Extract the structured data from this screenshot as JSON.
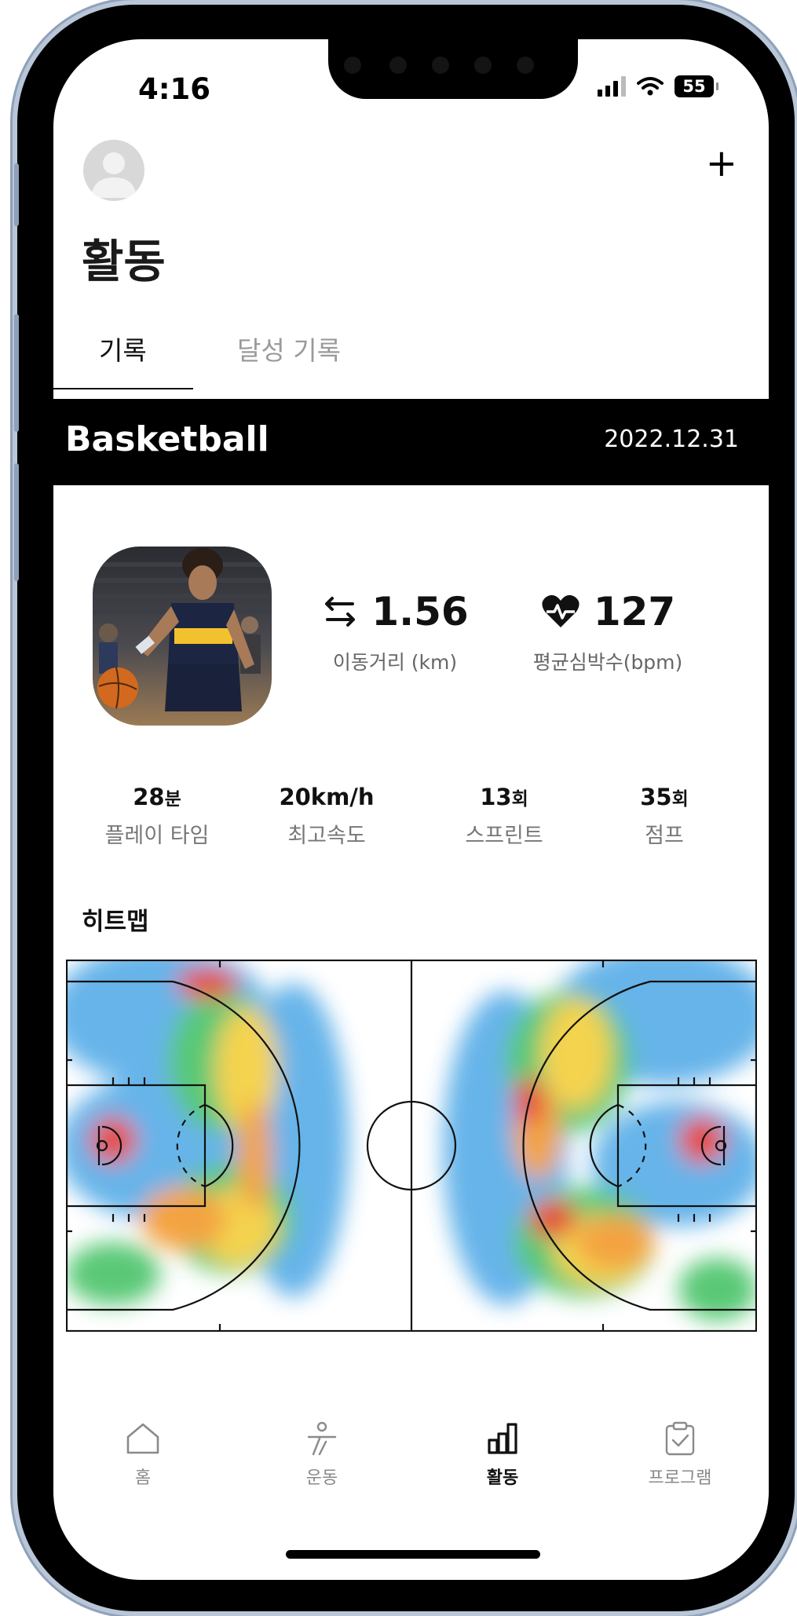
{
  "status_bar": {
    "time": "4:16",
    "battery": "55"
  },
  "header": {
    "add_label": "+",
    "title": "활동"
  },
  "tabs": [
    {
      "label": "기록",
      "active": true
    },
    {
      "label": "달성 기록",
      "active": false
    }
  ],
  "activity": {
    "sport": "Basketball",
    "date": "2022.12.31",
    "distance": {
      "value": "1.56",
      "label": "이동거리 (km)",
      "icon": "arrows-swap-icon"
    },
    "heart_rate": {
      "value": "127",
      "label": "평균심박수(bpm)",
      "icon": "heart-pulse-icon"
    },
    "stats": [
      {
        "num": "28",
        "unit": "분",
        "label": "플레이 타임"
      },
      {
        "num": "20km/h",
        "unit": "",
        "label": "최고속도"
      },
      {
        "num": "13",
        "unit": "회",
        "label": "스프린트"
      },
      {
        "num": "35",
        "unit": "회",
        "label": "점프"
      }
    ]
  },
  "heatmap": {
    "title": "히트맵",
    "legend_colors": {
      "low": "#5aaee8",
      "mid": "#4cc46a",
      "high": "#f4d03f",
      "higher": "#f39c32",
      "peak": "#e53b28"
    }
  },
  "bottom_nav": [
    {
      "label": "홈",
      "icon": "home-icon",
      "active": false
    },
    {
      "label": "운동",
      "icon": "running-person-icon",
      "active": false
    },
    {
      "label": "활동",
      "icon": "bar-chart-icon",
      "active": true
    },
    {
      "label": "프로그램",
      "icon": "clipboard-check-icon",
      "active": false
    }
  ],
  "colors": {
    "accent": "#000000",
    "text_secondary": "#777777",
    "tab_inactive": "#9a9a9a"
  }
}
